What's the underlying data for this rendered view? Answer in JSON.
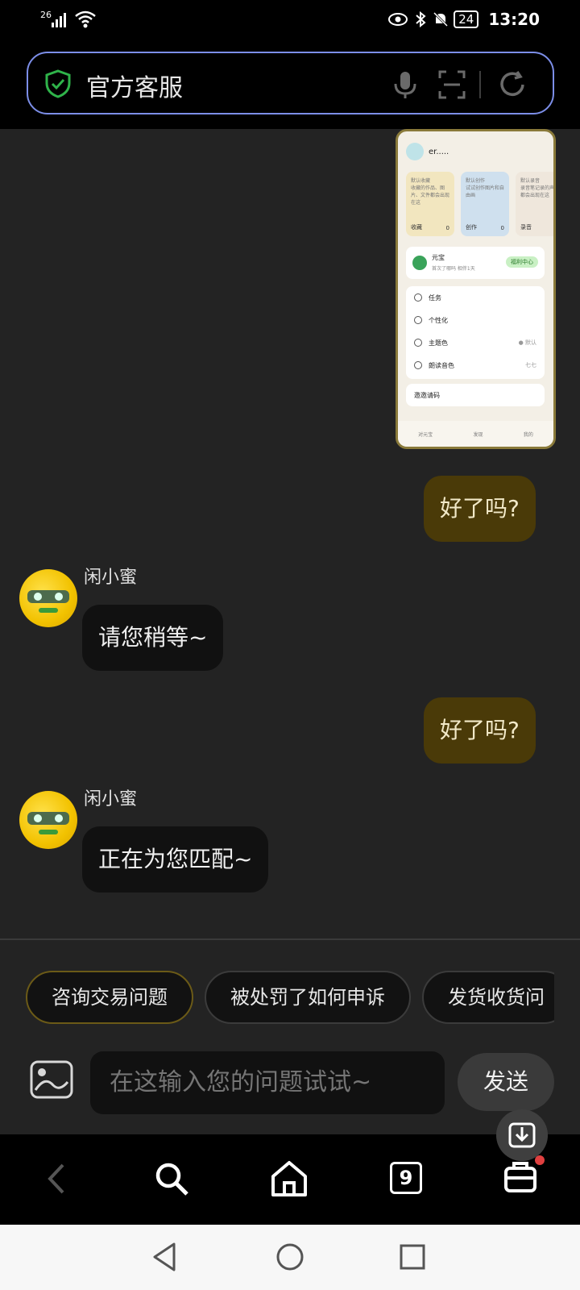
{
  "status_bar": {
    "signal_label": "26",
    "time": "13:20",
    "battery": "24"
  },
  "address_bar": {
    "title": "官方客服"
  },
  "chat": {
    "messages": [
      {
        "from": "me",
        "text": "好了吗?"
      },
      {
        "from": "them",
        "sender": "闲小蜜",
        "text": "请您稍等~"
      },
      {
        "from": "me",
        "text": "好了吗?"
      },
      {
        "from": "them",
        "sender": "闲小蜜",
        "text": "正在为您匹配~"
      }
    ],
    "screenshot": {
      "profile_name": "er.....",
      "cards": [
        {
          "title": "默认收藏",
          "desc": "收藏的作品、图片、文件都会出现在这",
          "label": "收藏",
          "count": "0",
          "color": "#f2e6bf"
        },
        {
          "title": "默认创作",
          "desc": "试试创作图片和自由画",
          "label": "创作",
          "count": "0",
          "color": "#cfe0ee"
        },
        {
          "title": "默认录音",
          "desc": "录音笔记录的声音都会出现在这",
          "label": "录音",
          "count": "0",
          "color": "#efe7dc"
        }
      ],
      "vip": {
        "name": "元宝",
        "sub": "首次了哪吗 相伴1天",
        "badge": "福利中心"
      },
      "list": [
        {
          "label": "任务",
          "value": ""
        },
        {
          "label": "个性化",
          "value": ""
        },
        {
          "label": "主题色",
          "value": "● 默认"
        },
        {
          "label": "朗读音色",
          "value": "七七"
        }
      ],
      "extra_row": "邀邀请码",
      "nav": [
        "对元宝",
        "发现",
        "我的"
      ]
    }
  },
  "quick_replies": [
    "咨询交易问题",
    "被处罚了如何申诉",
    "发货收货问"
  ],
  "input": {
    "placeholder": "在这输入您的问题试试~"
  },
  "send_label": "发送",
  "browser_nav": {
    "tab_count": "9"
  },
  "colors": {
    "accent_border": "#7c8ee8",
    "my_bubble": "#4a3a08",
    "their_bubble": "#111111",
    "shield_green": "#2fb34a"
  }
}
